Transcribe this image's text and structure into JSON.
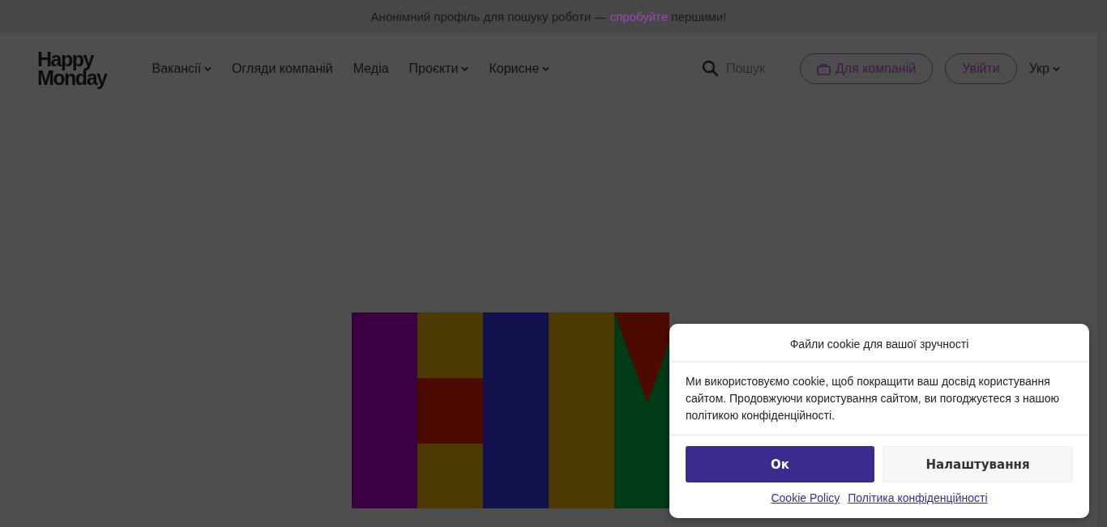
{
  "banner": {
    "text_before": "Анонімний профіль для пошуку роботи —",
    "link": "спробуйте",
    "text_after": "першими!"
  },
  "logo": {
    "line_1": "Happy",
    "line_2": "Monday"
  },
  "nav": [
    {
      "label": "Вакансії",
      "has_dropdown": true
    },
    {
      "label": "Огляди компаній",
      "has_dropdown": false
    },
    {
      "label": "Медіа",
      "has_dropdown": false
    },
    {
      "label": "Проєкти",
      "has_dropdown": true
    },
    {
      "label": "Корисне",
      "has_dropdown": true
    }
  ],
  "search": {
    "placeholder": "Пошук"
  },
  "for_companies_button": "Для компаній",
  "login_button": "Увійти",
  "language": {
    "label": "Укр",
    "has_dropdown": true
  },
  "cookie_dialog": {
    "title": "Файли cookie для вашої зручності",
    "text": "Ми використовуємо cookie, щоб покращити ваш досвід користування сайтом. Продовжуючи користування сайтом, ви погоджуєтеся з нашою політикою конфіденційності.",
    "buttons": [
      {
        "label": "Ок",
        "kind": "primary"
      },
      {
        "label": "Налаштування",
        "kind": "secondary"
      }
    ],
    "links": [
      "Cookie Policy",
      "Політика конфіденційності"
    ]
  }
}
